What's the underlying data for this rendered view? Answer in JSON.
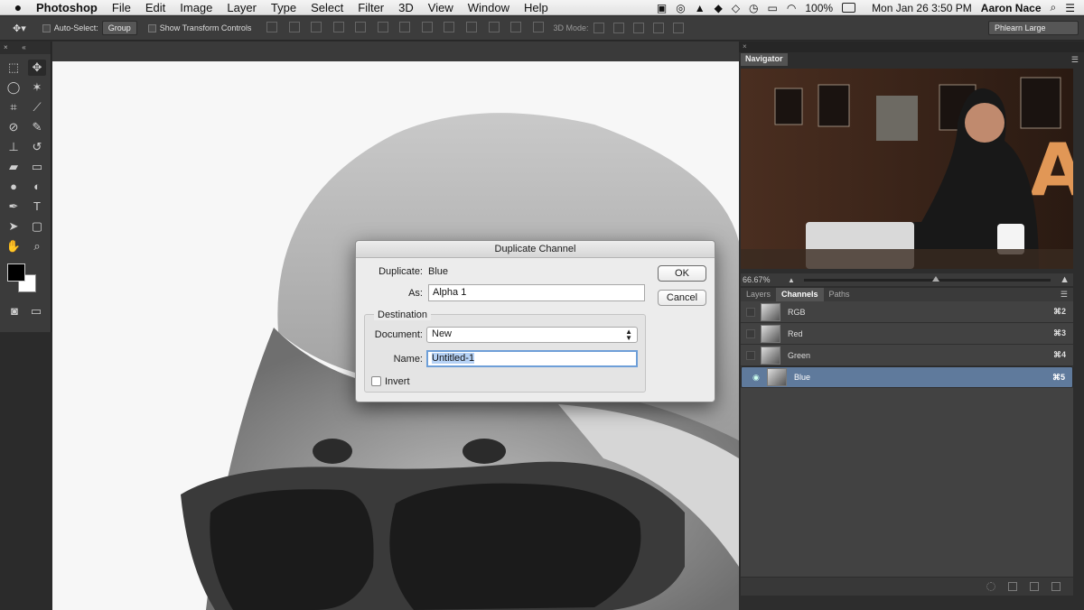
{
  "menubar": {
    "apple": "",
    "app": "Photoshop",
    "items": [
      "File",
      "Edit",
      "Image",
      "Layer",
      "Type",
      "Select",
      "Filter",
      "3D",
      "View",
      "Window",
      "Help"
    ],
    "battery": "100%",
    "datetime": "Mon Jan 26  3:50 PM",
    "user": "Aaron Nace"
  },
  "options": {
    "auto_select": "Auto-Select:",
    "auto_select_value": "Group",
    "show_transform": "Show Transform Controls",
    "mode_3d": "3D Mode:",
    "workspace": "Phlearn Large"
  },
  "navigator": {
    "tab": "Navigator",
    "zoom": "66.67%"
  },
  "channels_panel": {
    "tabs": [
      "Layers",
      "Channels",
      "Paths"
    ],
    "rows": [
      {
        "name": "RGB",
        "shortcut": "⌘2"
      },
      {
        "name": "Red",
        "shortcut": "⌘3"
      },
      {
        "name": "Green",
        "shortcut": "⌘4"
      },
      {
        "name": "Blue",
        "shortcut": "⌘5"
      }
    ]
  },
  "dialog": {
    "title": "Duplicate Channel",
    "duplicate_label": "Duplicate:",
    "duplicate_value": "Blue",
    "as_label": "As:",
    "as_value": "Alpha 1",
    "destination_label": "Destination",
    "document_label": "Document:",
    "document_value": "New",
    "name_label": "Name:",
    "name_value": "Untitled-1",
    "invert_label": "Invert",
    "ok": "OK",
    "cancel": "Cancel"
  }
}
